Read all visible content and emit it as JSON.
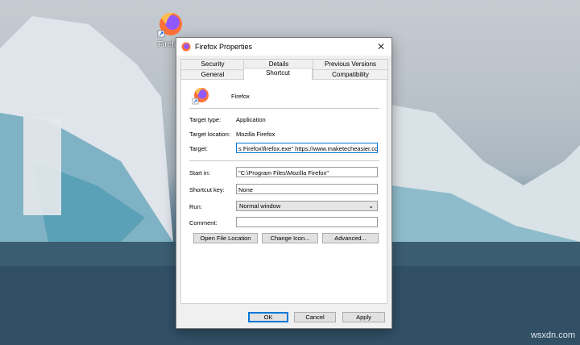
{
  "desktop": {
    "icon_label": "Firefo",
    "watermark": "wsxdn.com"
  },
  "dialog": {
    "title": "Firefox Properties",
    "tabs_top": [
      "Security",
      "Details",
      "Previous Versions"
    ],
    "tabs_bottom": [
      "General",
      "Shortcut",
      "Compatibility"
    ],
    "active_tab": "Shortcut",
    "app_name": "Firefox",
    "target_type_label": "Target type:",
    "target_type_value": "Application",
    "target_location_label": "Target location:",
    "target_location_value": "Mozilla Firefox",
    "target_label": "Target:",
    "target_value": "s Firefox\\firefox.exe\" https://www.maketecheasier.com",
    "start_in_label": "Start in:",
    "start_in_value": "\"C:\\Program Files\\Mozilla Firefox\"",
    "shortcut_key_label": "Shortcut key:",
    "shortcut_key_value": "None",
    "run_label": "Run:",
    "run_value": "Normal window",
    "comment_label": "Comment:",
    "comment_value": "",
    "open_location_button": "Open File Location",
    "change_icon_button": "Change Icon...",
    "advanced_button": "Advanced...",
    "ok_button": "OK",
    "cancel_button": "Cancel",
    "apply_button": "Apply"
  }
}
